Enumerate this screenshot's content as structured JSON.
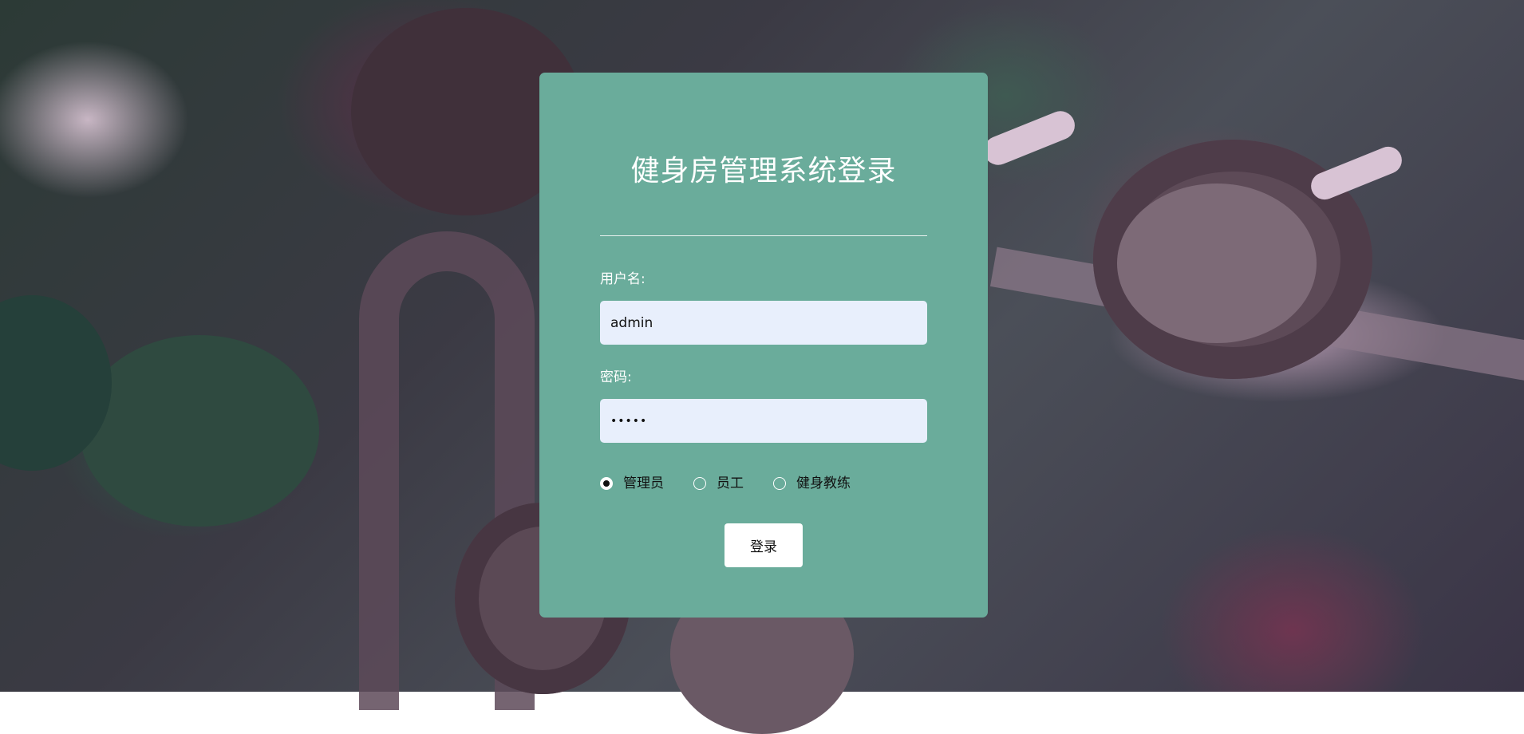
{
  "login": {
    "title": "健身房管理系统登录",
    "username_label": "用户名:",
    "username_value": "admin",
    "password_label": "密码:",
    "password_value": "•••••",
    "roles": [
      {
        "label": "管理员",
        "checked": true
      },
      {
        "label": "员工",
        "checked": false
      },
      {
        "label": "健身教练",
        "checked": false
      }
    ],
    "submit_label": "登录"
  },
  "colors": {
    "panel": "#6aac9b",
    "input_bg": "#e8effc",
    "text_light": "#ffffff"
  },
  "background": {
    "icon": "gym-dumbbell-rack-photo"
  }
}
